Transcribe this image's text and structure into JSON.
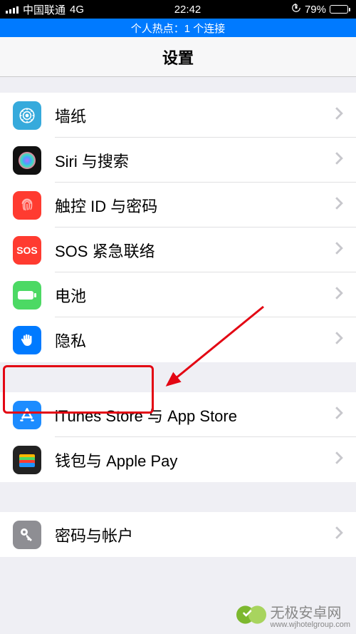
{
  "status": {
    "carrier": "中国联通",
    "network": "4G",
    "time": "22:42",
    "battery_percent": "79%",
    "battery_fill": 79
  },
  "hotspot": {
    "text": "个人热点：1 个连接"
  },
  "nav": {
    "title": "设置"
  },
  "sections": [
    {
      "items": [
        {
          "id": "wallpaper",
          "label": "墙纸",
          "icon": "wallpaper-icon",
          "bg": "#36aadc"
        },
        {
          "id": "siri",
          "label": "Siri 与搜索",
          "icon": "siri-icon",
          "bg": "#111"
        },
        {
          "id": "touchid",
          "label": "触控 ID 与密码",
          "icon": "fingerprint-icon",
          "bg": "#ff3b30"
        },
        {
          "id": "sos",
          "label": "SOS 紧急联络",
          "icon": "sos-icon",
          "bg": "#ff3b30"
        },
        {
          "id": "battery",
          "label": "电池",
          "icon": "battery-icon",
          "bg": "#4cd964"
        },
        {
          "id": "privacy",
          "label": "隐私",
          "icon": "hand-icon",
          "bg": "#007aff"
        }
      ]
    },
    {
      "items": [
        {
          "id": "itunes",
          "label": "iTunes Store 与 App Store",
          "icon": "appstore-icon",
          "bg": "#1d8cff"
        },
        {
          "id": "wallet",
          "label": "钱包与 Apple Pay",
          "icon": "wallet-icon",
          "bg": "#222"
        }
      ]
    },
    {
      "items": [
        {
          "id": "accounts",
          "label": "密码与帐户",
          "icon": "key-icon",
          "bg": "#8e8e93"
        }
      ]
    }
  ],
  "watermark": {
    "text": "无极安卓网",
    "url": "www.wjhotelgroup.com"
  },
  "annotation": {
    "highlight_target": "privacy"
  }
}
